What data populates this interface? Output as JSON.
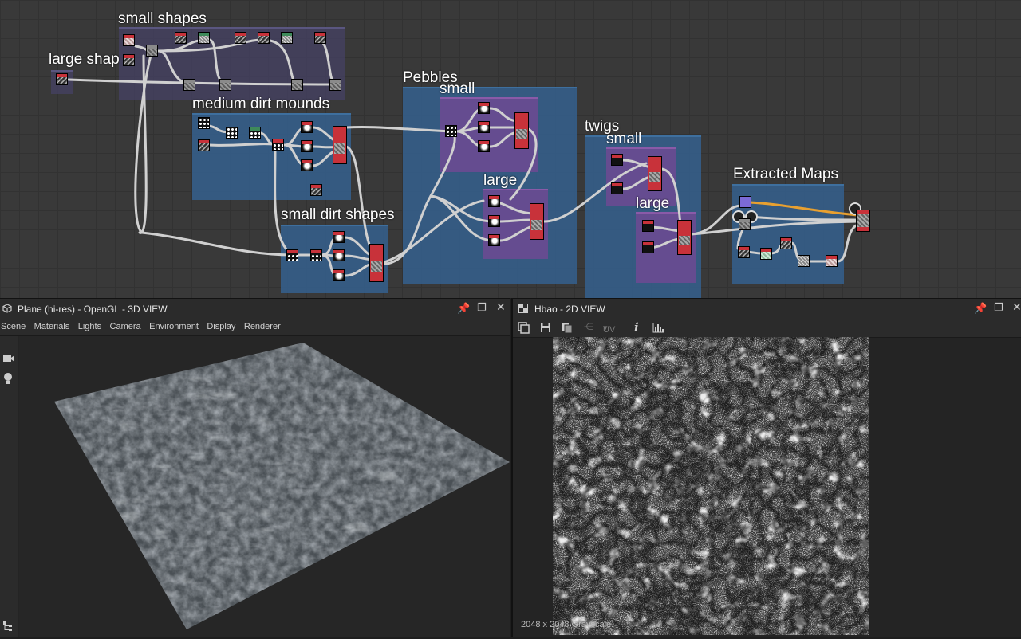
{
  "graph": {
    "frames": {
      "small_shapes": "small shapes",
      "large_shapes": "large shap",
      "medium_dirt_mounds": "medium dirt mounds",
      "small_dirt_shapes": "small dirt shapes",
      "pebbles": "Pebbles",
      "pebbles_small": "small",
      "pebbles_large": "large",
      "twigs": "twigs",
      "twigs_small": "small",
      "twigs_large": "large",
      "extracted_maps": "Extracted Maps"
    },
    "colors": {
      "wire": "#d0d0d0",
      "wire_orange": "#e8a030",
      "frame_blue": "#34649a",
      "frame_purple": "#784696",
      "output_red": "#c8323a"
    }
  },
  "view3d": {
    "title": "Plane (hi-res) - OpenGL - 3D VIEW",
    "menu": [
      "Scene",
      "Materials",
      "Lights",
      "Camera",
      "Environment",
      "Display",
      "Renderer"
    ],
    "icons": [
      "cube-icon",
      "pin-icon",
      "maximize-icon",
      "close-icon",
      "camera-icon",
      "light-bulb-icon",
      "hierarchy-icon"
    ]
  },
  "view2d": {
    "title": "Hbao - 2D VIEW",
    "uv_label": "UV",
    "status": "2048 x 2048 Grayscale",
    "icons": [
      "fit-icon",
      "save-icon",
      "copy-icon",
      "share-icon",
      "info-icon",
      "histogram-icon",
      "pin-icon",
      "maximize-icon",
      "close-icon"
    ]
  }
}
